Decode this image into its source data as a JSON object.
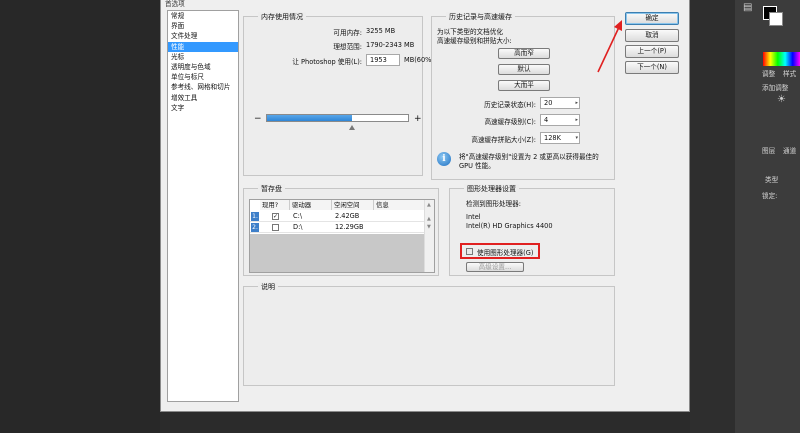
{
  "dialog_title": "首选项",
  "nav_items": [
    "常规",
    "界面",
    "文件处理",
    "性能",
    "光标",
    "透明度与色域",
    "单位与标尺",
    "参考线、网格和切片",
    "增效工具",
    "文字"
  ],
  "memory": {
    "title": "内存使用情况",
    "available_label": "可用内存:",
    "available_value": "3255 MB",
    "ideal_label": "理想范围:",
    "ideal_value": "1790-2343 MB",
    "ps_label": "让 Photoshop 使用(L):",
    "ps_value": "1953",
    "ps_unit": "MB(60%)",
    "minus": "−",
    "plus": "+",
    "slider_fraction": 0.6
  },
  "history": {
    "title": "历史记录与高速缓存",
    "desc1": "为以下类型的文档优化",
    "desc2": "高速缓存级别和拼贴大小:",
    "btn_tall": "高而窄",
    "btn_default": "默认",
    "btn_big": "大而平",
    "states_label": "历史记录状态(H):",
    "states_value": "20",
    "cache_levels_label": "高速缓存级别(C):",
    "cache_levels_value": "4",
    "tile_label": "高速缓存拼贴大小(Z):",
    "tile_value": "128K",
    "note1": "将\"高速缓存级别\"设置为 2 或更高以获得最佳的",
    "note2": "GPU 性能。"
  },
  "scratch": {
    "title": "暂存盘",
    "col_active": "现用?",
    "col_drive": "驱动器",
    "col_space": "空闲空间",
    "col_info": "信息",
    "rows": [
      {
        "num": "1.",
        "checked": "✓",
        "drive": "C:\\",
        "space": "2.42GB",
        "info": ""
      },
      {
        "num": "2.",
        "checked": "",
        "drive": "D:\\",
        "space": "12.29GB",
        "info": ""
      }
    ]
  },
  "gpu": {
    "title": "图形处理器设置",
    "detected": "检测到图形处理器:",
    "vendor": "Intel",
    "model": "Intel(R) HD Graphics 4400",
    "use_gpu_label": "使用图形处理器(G)",
    "advanced_label": "高级设置..."
  },
  "description": {
    "title": "说明"
  },
  "buttons": {
    "ok": "确定",
    "cancel": "取消",
    "prev": "上一个(P)",
    "next": "下一个(N)"
  },
  "ps_panel": {
    "tab1": "调整",
    "tab2": "样式",
    "add_adjust": "添加调整",
    "layers": "图层",
    "channels": "通道",
    "kind": "类型",
    "lock": "锁定:"
  },
  "colors": {
    "accent": "#3399ff",
    "highlight": "#e02020"
  }
}
